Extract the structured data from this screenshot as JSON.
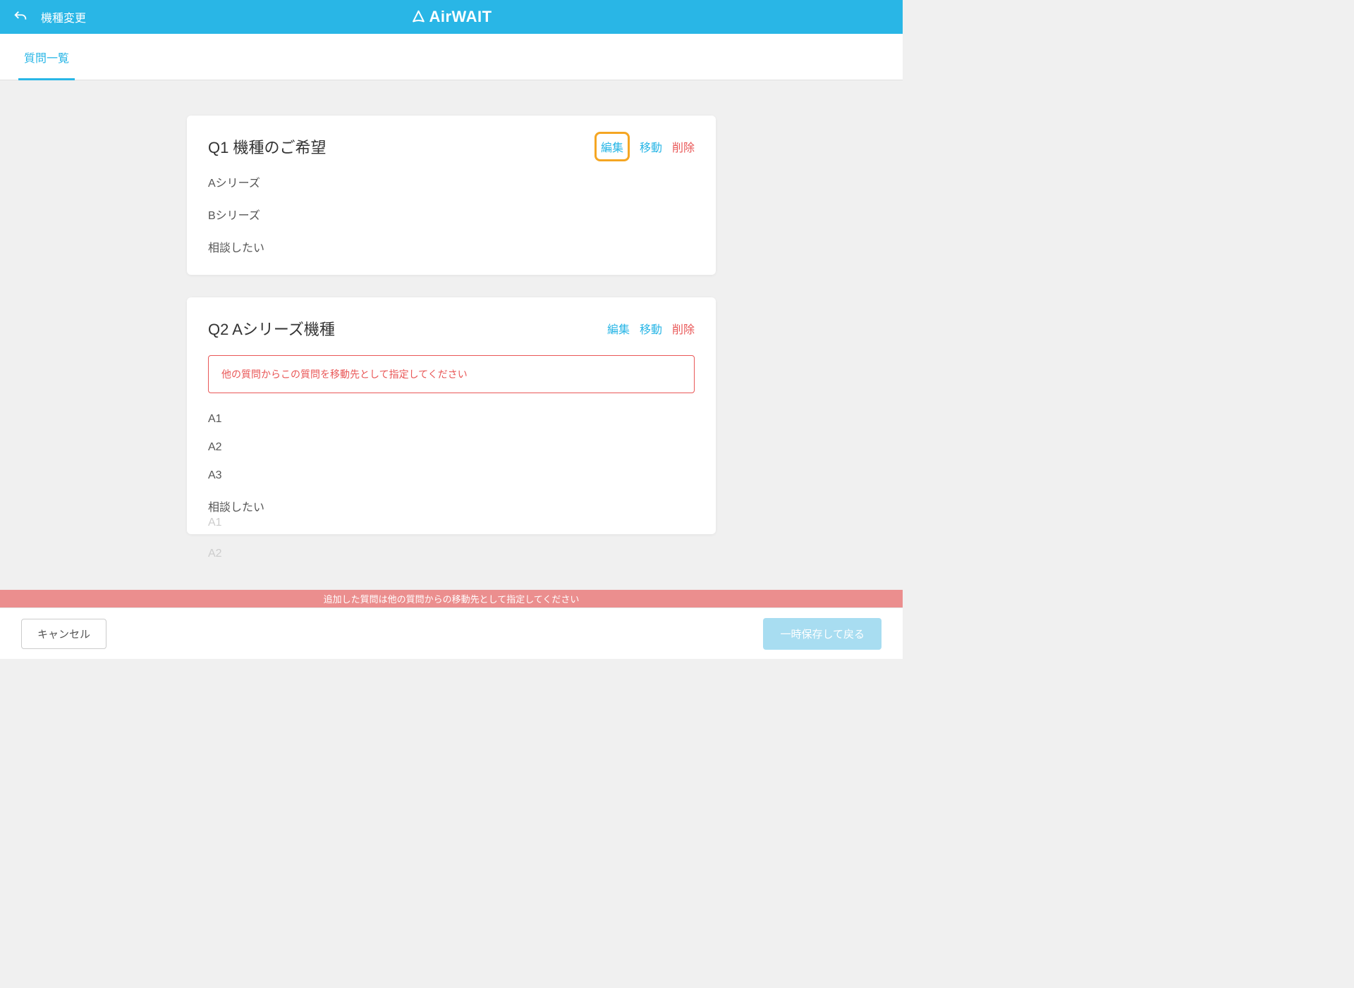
{
  "header": {
    "back_label": "戻る",
    "page_context": "機種変更",
    "logo_text": "AirWAIT"
  },
  "tabs": [
    {
      "label": "質問一覧",
      "active": true
    }
  ],
  "questions": [
    {
      "id_prefix": "Q1",
      "title": "Q1 機種のご希望",
      "actions": {
        "edit": "編集",
        "move": "移動",
        "delete": "削除"
      },
      "highlight_edit": true,
      "warning": null,
      "options": [
        "Aシリーズ",
        "Bシリーズ",
        "相談したい"
      ]
    },
    {
      "id_prefix": "Q2",
      "title": "Q2 Aシリーズ機種",
      "actions": {
        "edit": "編集",
        "move": "移動",
        "delete": "削除"
      },
      "highlight_edit": false,
      "warning": "他の質問からこの質問を移動先として指定してください",
      "options": [
        "A1",
        "A2",
        "A3",
        "相談したい"
      ]
    }
  ],
  "faded_options": [
    "A1",
    "A2"
  ],
  "banner_text": "追加した質問は他の質問からの移動先として指定してください",
  "footer": {
    "cancel": "キャンセル",
    "save": "一時保存して戻る"
  }
}
